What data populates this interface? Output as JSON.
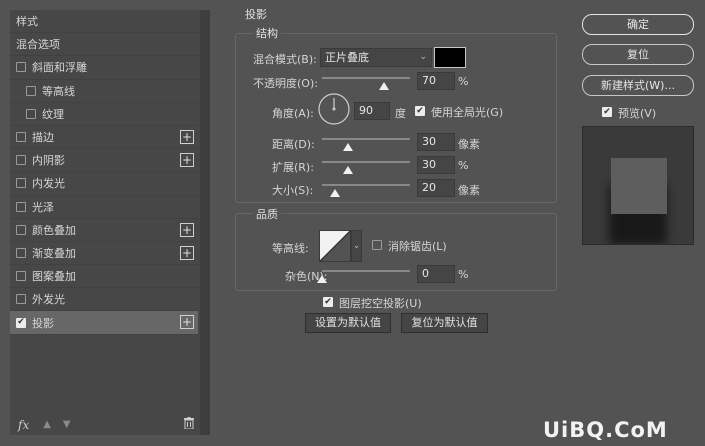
{
  "left_panel": {
    "header": "样式",
    "items": [
      {
        "label": "混合选项",
        "checkbox": false,
        "checked": false,
        "indent": false,
        "plus": false,
        "selected": false
      },
      {
        "label": "斜面和浮雕",
        "checkbox": true,
        "checked": false,
        "indent": false,
        "plus": false,
        "selected": false
      },
      {
        "label": "等高线",
        "checkbox": true,
        "checked": false,
        "indent": true,
        "plus": false,
        "selected": false
      },
      {
        "label": "纹理",
        "checkbox": true,
        "checked": false,
        "indent": true,
        "plus": false,
        "selected": false
      },
      {
        "label": "描边",
        "checkbox": true,
        "checked": false,
        "indent": false,
        "plus": true,
        "selected": false
      },
      {
        "label": "内阴影",
        "checkbox": true,
        "checked": false,
        "indent": false,
        "plus": true,
        "selected": false
      },
      {
        "label": "内发光",
        "checkbox": true,
        "checked": false,
        "indent": false,
        "plus": false,
        "selected": false
      },
      {
        "label": "光泽",
        "checkbox": true,
        "checked": false,
        "indent": false,
        "plus": false,
        "selected": false
      },
      {
        "label": "颜色叠加",
        "checkbox": true,
        "checked": false,
        "indent": false,
        "plus": true,
        "selected": false
      },
      {
        "label": "渐变叠加",
        "checkbox": true,
        "checked": false,
        "indent": false,
        "plus": true,
        "selected": false
      },
      {
        "label": "图案叠加",
        "checkbox": true,
        "checked": false,
        "indent": false,
        "plus": false,
        "selected": false
      },
      {
        "label": "外发光",
        "checkbox": true,
        "checked": false,
        "indent": false,
        "plus": false,
        "selected": false
      },
      {
        "label": "投影",
        "checkbox": true,
        "checked": true,
        "indent": false,
        "plus": true,
        "selected": true
      }
    ],
    "footer": {
      "fx_label": "fx",
      "icons": [
        "arrow-up-icon",
        "arrow-down-icon",
        "trash-icon"
      ]
    }
  },
  "drop_shadow": {
    "title": "投影",
    "structure": {
      "title": "结构",
      "blend_mode_label": "混合模式(B):",
      "blend_mode_value": "正片叠底",
      "shadow_color": "#000000",
      "opacity_label": "不透明度(O):",
      "opacity_value": "70",
      "opacity_unit": "%",
      "opacity_fraction": 0.7,
      "angle_label": "角度(A):",
      "angle_value": "90",
      "angle_unit": "度",
      "global_light_label": "使用全局光(G)",
      "global_light_checked": true,
      "distance_label": "距离(D):",
      "distance_value": "30",
      "distance_unit": "像素",
      "distance_fraction": 0.3,
      "spread_label": "扩展(R):",
      "spread_value": "30",
      "spread_unit": "%",
      "spread_fraction": 0.3,
      "size_label": "大小(S):",
      "size_value": "20",
      "size_unit": "像素",
      "size_fraction": 0.15
    },
    "quality": {
      "title": "品质",
      "contour_label": "等高线:",
      "antialias_label": "消除锯齿(L)",
      "antialias_checked": false,
      "noise_label": "杂色(N):",
      "noise_value": "0",
      "noise_unit": "%",
      "noise_fraction": 0
    },
    "knockout_label": "图层挖空投影(U)",
    "knockout_checked": true,
    "set_default_label": "设置为默认值",
    "reset_default_label": "复位为默认值"
  },
  "right_panel": {
    "ok_label": "确定",
    "reset_label": "复位",
    "new_style_label": "新建样式(W)...",
    "preview_label": "预览(V)",
    "preview_checked": true
  },
  "watermark": "UiBQ.CoM"
}
